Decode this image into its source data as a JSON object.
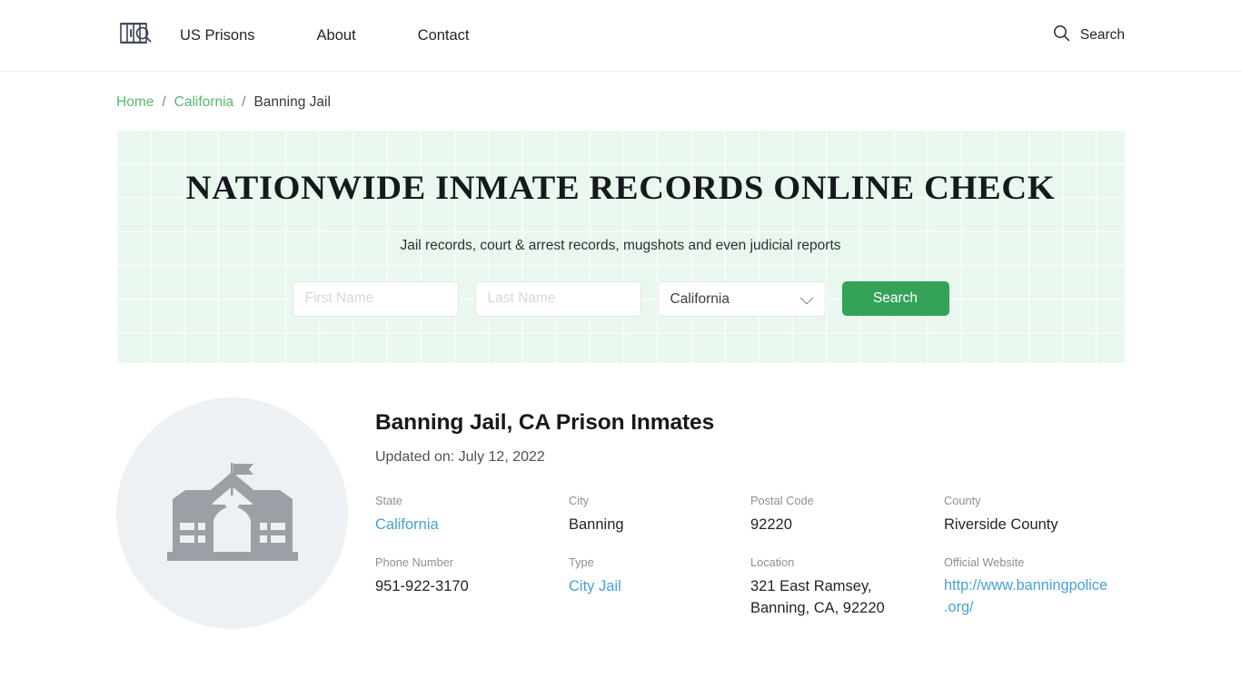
{
  "header": {
    "logo_icon": "jail-bars-magnifier-logo",
    "nav": [
      {
        "label": "US Prisons"
      },
      {
        "label": "About"
      },
      {
        "label": "Contact"
      }
    ],
    "search": {
      "icon": "search-icon",
      "label": "Search"
    }
  },
  "breadcrumb": {
    "separator": "/",
    "items": [
      {
        "label": "Home",
        "link": true
      },
      {
        "label": "California",
        "link": true
      },
      {
        "label": "Banning Jail",
        "link": false
      }
    ]
  },
  "hero": {
    "title": "NATIONWIDE INMATE RECORDS ONLINE CHECK",
    "subtitle": "Jail records, court & arrest records, mugshots and even judicial reports",
    "form": {
      "first_name": {
        "value": "",
        "placeholder": "First Name"
      },
      "last_name": {
        "value": "",
        "placeholder": "Last Name"
      },
      "state": {
        "selected": "California",
        "options": [
          "California"
        ]
      },
      "submit_label": "Search"
    },
    "background_color": "#e9f7ee",
    "accent_color": "#34a259"
  },
  "main": {
    "photo": {
      "icon": "institution-building-icon",
      "circle_color": "#edf1f4",
      "icon_color": "#9aa0a6"
    },
    "title": "Banning Jail, CA Prison Inmates",
    "updated": "Updated on: July 12, 2022",
    "facts": [
      {
        "label": "State",
        "value": "California",
        "link": true
      },
      {
        "label": "City",
        "value": "Banning",
        "link": false
      },
      {
        "label": "Postal Code",
        "value": "92220",
        "link": false
      },
      {
        "label": "County",
        "value": "Riverside County",
        "link": false
      },
      {
        "label": "Phone Number",
        "value": "951-922-3170",
        "link": false
      },
      {
        "label": "Type",
        "value": "City Jail",
        "link": true
      },
      {
        "label": "Location",
        "value": "321 East Ramsey, Banning, CA, 92220",
        "link": false
      },
      {
        "label": "Official Website",
        "value": "http://www.banningpolice.org/",
        "link": true
      }
    ],
    "link_color": "#4a9fd4"
  }
}
